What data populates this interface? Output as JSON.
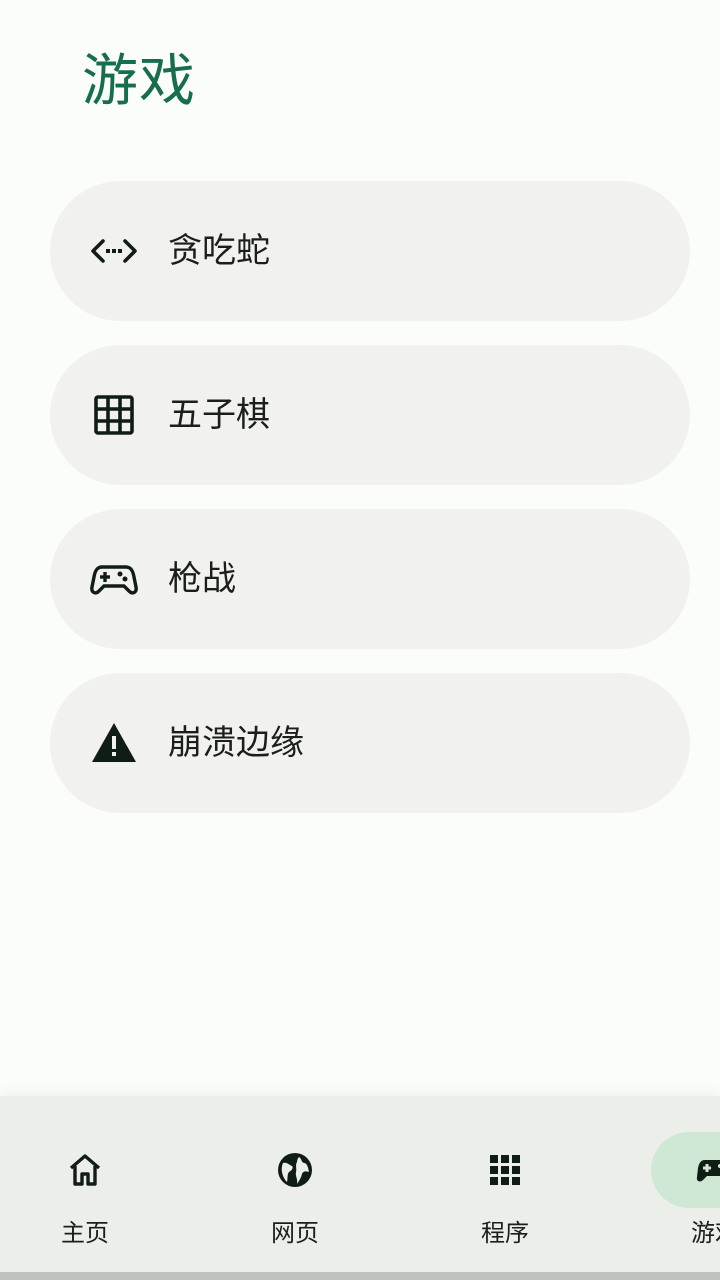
{
  "page": {
    "title": "游戏"
  },
  "games": [
    {
      "label": "贪吃蛇",
      "icon": "code-arrows-icon"
    },
    {
      "label": "五子棋",
      "icon": "grid-icon"
    },
    {
      "label": "枪战",
      "icon": "gamepad-icon"
    },
    {
      "label": "崩溃边缘",
      "icon": "warning-icon"
    }
  ],
  "bottom_nav": {
    "items": [
      {
        "label": "主页",
        "icon": "home-icon",
        "active": false
      },
      {
        "label": "网页",
        "icon": "globe-icon",
        "active": false
      },
      {
        "label": "程序",
        "icon": "apps-grid-icon",
        "active": false
      },
      {
        "label": "游戏",
        "icon": "gamepad-icon",
        "active": true
      }
    ]
  },
  "colors": {
    "background": "#fbfdf9",
    "title": "#176e4e",
    "card": "#f1f2ee",
    "nav_background": "#eceeea",
    "nav_active_pill": "#cfe8d6",
    "icon": "#0f1d15"
  }
}
